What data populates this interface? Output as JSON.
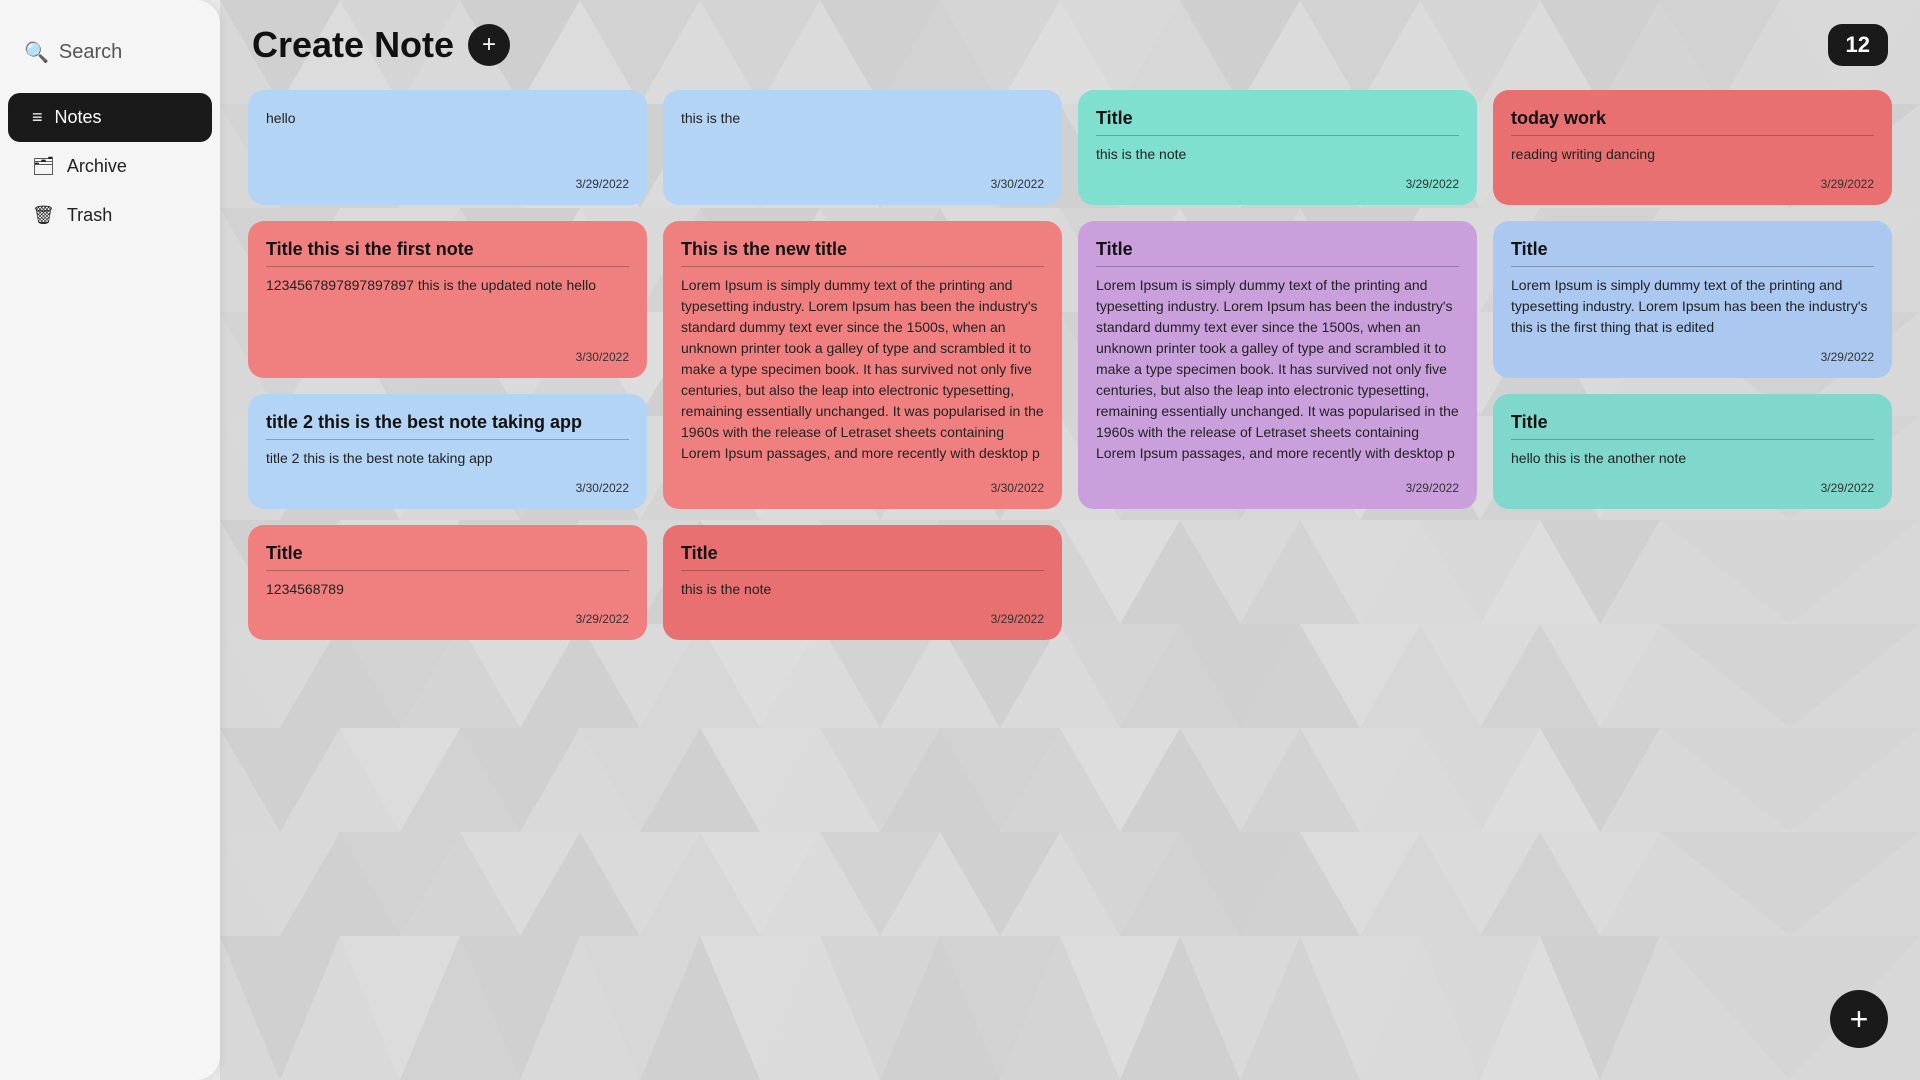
{
  "sidebar": {
    "search_label": "Search",
    "nav_items": [
      {
        "id": "notes",
        "label": "Notes",
        "icon": "≡",
        "active": true
      },
      {
        "id": "archive",
        "label": "Archive",
        "icon": "🗂",
        "active": false
      },
      {
        "id": "trash",
        "label": "Trash",
        "icon": "🗑",
        "active": false
      }
    ]
  },
  "header": {
    "title": "Create Note",
    "count": "12"
  },
  "notes": [
    {
      "id": 1,
      "color": "blue-light",
      "title": "",
      "body": "hello",
      "date": "3/29/2022",
      "tall": false
    },
    {
      "id": 2,
      "color": "blue-light",
      "title": "",
      "body": "this is the",
      "date": "3/30/2022",
      "tall": false
    },
    {
      "id": 3,
      "color": "teal",
      "title": "Title",
      "body": "this is the note",
      "date": "3/29/2022",
      "tall": false
    },
    {
      "id": 4,
      "color": "red-light",
      "title": "today work",
      "body": "reading writing dancing",
      "date": "3/29/2022",
      "tall": false
    },
    {
      "id": 5,
      "color": "pink",
      "title": "Title this si the first note",
      "body": "1234567897897897897 this is the updated note hello",
      "date": "3/30/2022",
      "tall": false
    },
    {
      "id": 6,
      "color": "pink",
      "title": "This is the new title",
      "body": "Lorem Ipsum is simply dummy text of the printing and typesetting industry. Lorem Ipsum has been the industry's standard dummy text ever since the 1500s, when an unknown printer took a galley of type and scrambled it to make a type specimen book. It has survived not only five centuries, but also the leap into electronic typesetting, remaining essentially unchanged. It was popularised in the 1960s with the release of Letraset sheets containing Lorem Ipsum passages, and more recently with desktop p",
      "date": "3/30/2022",
      "tall": true
    },
    {
      "id": 7,
      "color": "purple",
      "title": "Title",
      "body": "Lorem Ipsum is simply dummy text of the printing and typesetting industry. Lorem Ipsum has been the industry's standard dummy text ever since the 1500s, when an unknown printer took a galley of type and scrambled it to make a type specimen book. It has survived not only five centuries, but also the leap into electronic typesetting, remaining essentially unchanged. It was popularised in the 1960s with the release of Letraset sheets containing Lorem Ipsum passages, and more recently with desktop p",
      "date": "3/29/2022",
      "tall": true
    },
    {
      "id": 8,
      "color": "blue-light2",
      "title": "Title",
      "body": "Lorem Ipsum is simply dummy text of the printing and typesetting industry. Lorem Ipsum has been the industry's this is the first thing that is edited",
      "date": "3/29/2022",
      "tall": false
    },
    {
      "id": 9,
      "color": "blue-light",
      "title": "title 2 this is the best note taking app",
      "body": "title 2 this is the best note taking app",
      "date": "3/30/2022",
      "tall": false
    },
    {
      "id": 10,
      "color": "cyan",
      "title": "Title",
      "body": "hello this is the another note",
      "date": "3/29/2022",
      "tall": false
    },
    {
      "id": 11,
      "color": "pink",
      "title": "Title",
      "body": "1234568789",
      "date": "3/29/2022",
      "tall": false
    },
    {
      "id": 12,
      "color": "red-light",
      "title": "Title",
      "body": "this is the note",
      "date": "3/29/2022",
      "tall": false
    }
  ],
  "fab_label": "+"
}
